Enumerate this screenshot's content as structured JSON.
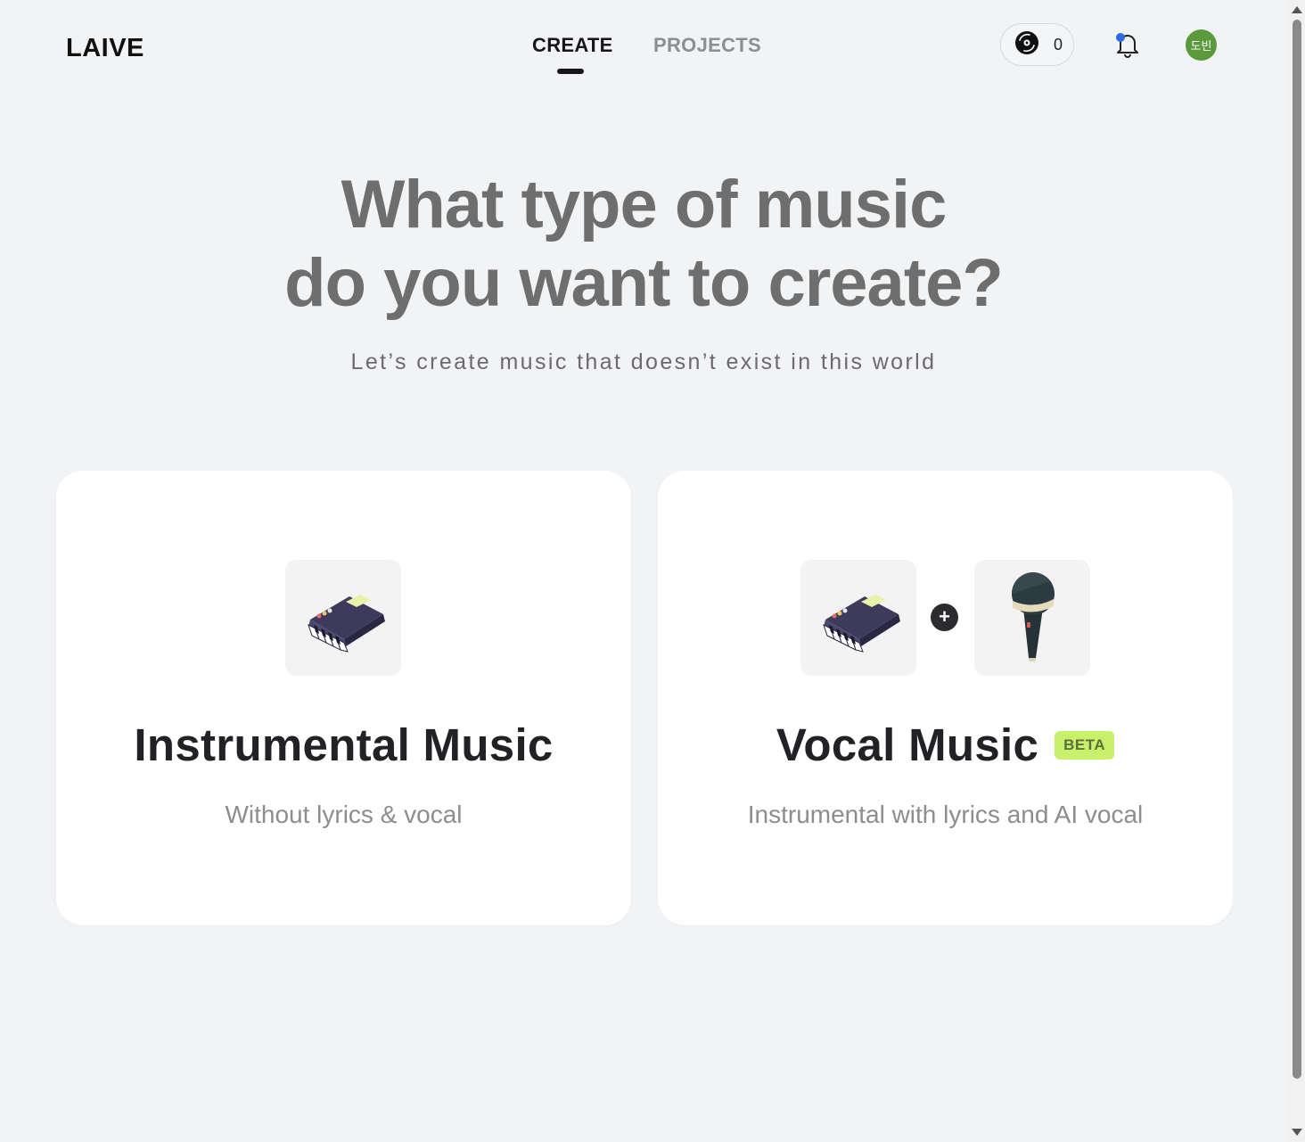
{
  "header": {
    "logo": "LAIVE",
    "tabs": [
      {
        "label": "CREATE",
        "active": true
      },
      {
        "label": "PROJECTS",
        "active": false
      }
    ],
    "credits": "0",
    "avatar_text": "도빈",
    "notification_dot_color": "#2d6be4",
    "avatar_color": "#5a9a3c"
  },
  "hero": {
    "title_line1": "What type of music",
    "title_line2": "do you want to create?",
    "subtitle": "Let’s create music that doesn’t exist in this world"
  },
  "cards": [
    {
      "title": "Instrumental Music",
      "description": "Without lyrics & vocal",
      "icons": [
        "keyboard-icon"
      ]
    },
    {
      "title": "Vocal Music",
      "badge": "BETA",
      "description": "Instrumental with lyrics and AI vocal",
      "icons": [
        "keyboard-icon",
        "plus-icon",
        "microphone-icon"
      ]
    }
  ],
  "colors": {
    "background": "#f2f3f5",
    "beta_badge": "#c8f06a",
    "title_gray": "#6e6e6e"
  }
}
